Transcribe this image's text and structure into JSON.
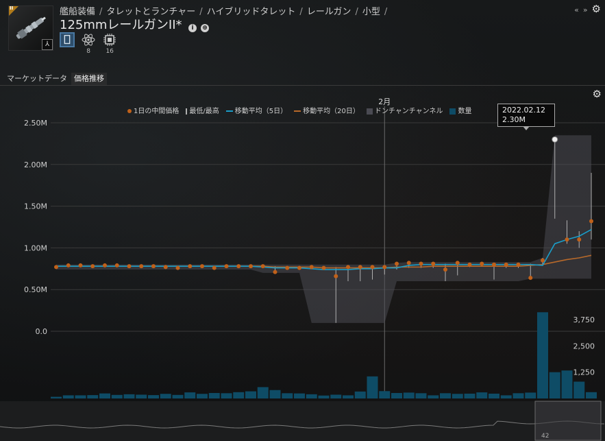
{
  "breadcrumb": [
    "艦船装備",
    "タレットとランチャー",
    "ハイブリッドタレット",
    "レールガン",
    "小型"
  ],
  "breadcrumb_sep": "/",
  "item": {
    "title": "125mmレールガンII*",
    "tech_badge": "II",
    "corner_mark": "⅄",
    "info_icon": "info-icon",
    "show_info_glyph": "i",
    "skills_glyph": "⊕"
  },
  "attributes": [
    {
      "icon": "module-icon",
      "value": ""
    },
    {
      "icon": "atom-icon",
      "value": "8"
    },
    {
      "icon": "cpu-chip-icon",
      "value": "16"
    }
  ],
  "window_controls": {
    "collapse": "«",
    "expand": "»",
    "gear": "⚙"
  },
  "tabs": [
    {
      "label": "マーケットデータ",
      "active": false
    },
    {
      "label": "価格推移",
      "active": true
    }
  ],
  "chart_gear": "⚙",
  "tooltip": {
    "date": "2022.02.12",
    "value": "2.30M"
  },
  "colors": {
    "median_dot": "#c0611a",
    "minmax": "#b0b0b0",
    "ma5": "#1a9ec9",
    "ma20": "#b8692a",
    "donchian": "#4a4a52",
    "volume": "#0e4c66",
    "grid": "#3a3a3a"
  },
  "chart_data": {
    "type": "line",
    "month_label": "2月",
    "y_ticks": [
      "0.0",
      "0.50M",
      "1.00M",
      "1.50M",
      "2.00M",
      "2.50M"
    ],
    "y_range": [
      0,
      2.5
    ],
    "volume_ticks": [
      "1,250",
      "2,500",
      "3,750"
    ],
    "volume_range": [
      0,
      4200
    ],
    "legend": [
      {
        "label": "1日の中間価格",
        "kind": "dot"
      },
      {
        "label": "最低/最高",
        "kind": "bar"
      },
      {
        "label": "移動平均（5日）",
        "kind": "ma5"
      },
      {
        "label": "移動平均（20日）",
        "kind": "ma20"
      },
      {
        "label": "ドンチャンチャンネル",
        "kind": "donchian"
      },
      {
        "label": "数量",
        "kind": "volume"
      }
    ],
    "median": [
      0.77,
      0.79,
      0.79,
      0.78,
      0.79,
      0.79,
      0.78,
      0.78,
      0.78,
      0.77,
      0.76,
      0.78,
      0.78,
      0.76,
      0.78,
      0.78,
      0.78,
      0.78,
      0.71,
      0.76,
      0.76,
      0.77,
      0.76,
      0.66,
      0.77,
      0.77,
      0.77,
      0.77,
      0.81,
      0.82,
      0.81,
      0.81,
      0.74,
      0.82,
      0.8,
      0.81,
      0.8,
      0.8,
      0.8,
      0.64,
      0.85,
      2.3,
      1.1,
      1.1,
      1.32
    ],
    "high": [
      0.79,
      0.8,
      0.8,
      0.79,
      0.8,
      0.8,
      0.79,
      0.79,
      0.79,
      0.78,
      0.78,
      0.79,
      0.79,
      0.78,
      0.79,
      0.79,
      0.79,
      0.79,
      0.78,
      0.78,
      0.78,
      0.79,
      0.78,
      0.77,
      0.79,
      0.79,
      0.79,
      0.79,
      0.82,
      0.83,
      0.82,
      0.82,
      0.81,
      0.83,
      0.82,
      0.82,
      0.82,
      0.82,
      0.82,
      0.81,
      0.88,
      2.3,
      1.33,
      1.2,
      1.9
    ],
    "low": [
      0.76,
      0.78,
      0.78,
      0.77,
      0.78,
      0.78,
      0.77,
      0.77,
      0.77,
      0.76,
      0.75,
      0.77,
      0.77,
      0.75,
      0.77,
      0.77,
      0.77,
      0.77,
      0.7,
      0.74,
      0.75,
      0.76,
      0.75,
      0.1,
      0.6,
      0.6,
      0.62,
      0.68,
      0.74,
      0.76,
      0.76,
      0.76,
      0.6,
      0.67,
      0.77,
      0.78,
      0.62,
      0.76,
      0.76,
      0.63,
      0.8,
      1.35,
      1.05,
      1.0,
      1.1
    ],
    "ma5": [
      0.78,
      0.78,
      0.78,
      0.78,
      0.78,
      0.78,
      0.78,
      0.78,
      0.78,
      0.78,
      0.78,
      0.78,
      0.78,
      0.78,
      0.78,
      0.78,
      0.78,
      0.77,
      0.76,
      0.76,
      0.76,
      0.75,
      0.74,
      0.74,
      0.74,
      0.75,
      0.75,
      0.76,
      0.76,
      0.79,
      0.8,
      0.8,
      0.8,
      0.8,
      0.8,
      0.8,
      0.8,
      0.8,
      0.8,
      0.8,
      0.79,
      1.05,
      1.1,
      1.14,
      1.22
    ],
    "ma20": [
      0.78,
      0.78,
      0.78,
      0.78,
      0.78,
      0.78,
      0.78,
      0.78,
      0.78,
      0.78,
      0.78,
      0.78,
      0.78,
      0.78,
      0.78,
      0.78,
      0.78,
      0.78,
      0.77,
      0.77,
      0.77,
      0.77,
      0.76,
      0.76,
      0.76,
      0.76,
      0.76,
      0.76,
      0.77,
      0.77,
      0.77,
      0.78,
      0.78,
      0.78,
      0.78,
      0.78,
      0.78,
      0.78,
      0.78,
      0.79,
      0.8,
      0.83,
      0.86,
      0.88,
      0.91
    ],
    "donchian_high": [
      0.8,
      0.8,
      0.8,
      0.8,
      0.8,
      0.8,
      0.8,
      0.8,
      0.8,
      0.8,
      0.8,
      0.8,
      0.8,
      0.8,
      0.8,
      0.8,
      0.8,
      0.8,
      0.8,
      0.8,
      0.8,
      0.8,
      0.8,
      0.8,
      0.8,
      0.8,
      0.8,
      0.8,
      0.82,
      0.83,
      0.83,
      0.83,
      0.83,
      0.83,
      0.83,
      0.83,
      0.83,
      0.83,
      0.83,
      0.83,
      0.88,
      2.35,
      2.35,
      2.35,
      2.35
    ],
    "donchian_low": [
      0.74,
      0.74,
      0.74,
      0.74,
      0.74,
      0.74,
      0.74,
      0.74,
      0.74,
      0.74,
      0.74,
      0.74,
      0.74,
      0.74,
      0.74,
      0.74,
      0.74,
      0.7,
      0.7,
      0.7,
      0.7,
      0.1,
      0.1,
      0.1,
      0.1,
      0.1,
      0.1,
      0.1,
      0.6,
      0.6,
      0.6,
      0.6,
      0.6,
      0.6,
      0.6,
      0.6,
      0.6,
      0.6,
      0.6,
      0.63,
      0.63,
      0.63,
      0.63,
      0.63,
      0.63
    ],
    "volume": [
      80,
      150,
      150,
      160,
      240,
      170,
      200,
      180,
      160,
      220,
      170,
      290,
      220,
      260,
      250,
      300,
      340,
      540,
      400,
      250,
      240,
      200,
      140,
      180,
      150,
      330,
      1050,
      350,
      260,
      280,
      250,
      150,
      250,
      220,
      230,
      290,
      230,
      150,
      250,
      280,
      4100,
      1250,
      1330,
      800,
      300
    ],
    "overview_label": "42"
  }
}
